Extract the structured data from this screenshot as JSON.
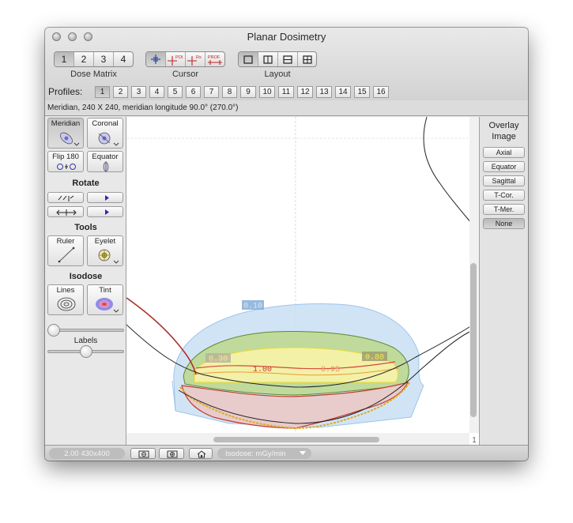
{
  "window": {
    "title": "Planar Dosimetry"
  },
  "toolbar": {
    "dose_matrix": {
      "label": "Dose Matrix",
      "options": [
        "1",
        "2",
        "3",
        "4"
      ],
      "selected": "1"
    },
    "cursor": {
      "label": "Cursor",
      "tools": [
        "crosshair-icon",
        "poi-cursor-icon",
        "rx-cursor-icon",
        "profile-cursor-icon"
      ],
      "texts": [
        "POI",
        "Rx",
        "PROF"
      ]
    },
    "layout": {
      "label": "Layout",
      "options": [
        "single-view-icon",
        "two-columns-icon",
        "two-rows-icon",
        "four-grid-icon"
      ],
      "selected": "single-view-icon"
    }
  },
  "profiles": {
    "label": "Profiles:",
    "items": [
      "1",
      "2",
      "3",
      "4",
      "5",
      "6",
      "7",
      "8",
      "9",
      "10",
      "11",
      "12",
      "13",
      "14",
      "15",
      "16"
    ],
    "selected": "1"
  },
  "info": {
    "text": "Meridian, 240 X 240, meridian longitude 90.0° (270.0°)"
  },
  "left_panel": {
    "views": {
      "meridian": "Meridian",
      "coronal": "Coronal",
      "flip180": "Flip 180",
      "equator": "Equator"
    },
    "rotate_title": "Rotate",
    "tools_title": "Tools",
    "tools": {
      "ruler": "Ruler",
      "eyelet": "Eyelet"
    },
    "isodose_title": "Isodose",
    "isodose": {
      "lines": "Lines",
      "tint": "Tint"
    },
    "labels_title": "Labels",
    "upper_slider_value": 0.0,
    "labels_slider_value": 0.5
  },
  "plot": {
    "isodose_labels": {
      "outer": "0.10",
      "left": "0.30",
      "right": "0.80",
      "center": "1.00",
      "mid": "0.95"
    },
    "colors": {
      "outer": "#c6ddf4",
      "green": "#bdd88c",
      "yellow": "#f8f3aa",
      "pink": "#e8cac8",
      "dark_red": "#b03028",
      "red": "#d8483c"
    }
  },
  "overlay": {
    "title_line1": "Overlay",
    "title_line2": "Image",
    "options": [
      "Axial",
      "Equator",
      "Sagittal",
      "T-Cor.",
      "T-Mer.",
      "None"
    ],
    "selected": "None"
  },
  "scrollbar": {
    "page": "1"
  },
  "status": {
    "zoom": "2.00 430x400",
    "isodose_popup": "Isodose: mGy/min"
  }
}
